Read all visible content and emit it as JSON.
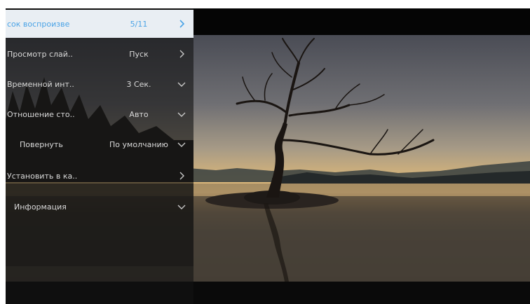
{
  "menu": {
    "items": [
      {
        "label": "сок воспроизве",
        "value": "5/11",
        "chevron": "chevron-right-icon",
        "active": true
      },
      {
        "label": "Просмотр слай..",
        "value": "Пуск",
        "chevron": "chevron-right-icon"
      },
      {
        "label": "Временной инт..",
        "value": "3 Сек.",
        "chevron": "chevron-down-icon"
      },
      {
        "label": "Отношение сто..",
        "value": "Авто",
        "chevron": "chevron-down-icon"
      },
      {
        "label": "Повернуть",
        "value": "По умолчанию",
        "chevron": "chevron-down-icon"
      },
      {
        "label": "Установить в ка..",
        "value": "",
        "chevron": "chevron-right-icon"
      },
      {
        "label": "Информация",
        "value": "",
        "chevron": "chevron-down-icon"
      }
    ]
  },
  "colors": {
    "accent": "#4aa3e6",
    "active_bg": "#e9eef3",
    "text": "#d9d9d9"
  }
}
